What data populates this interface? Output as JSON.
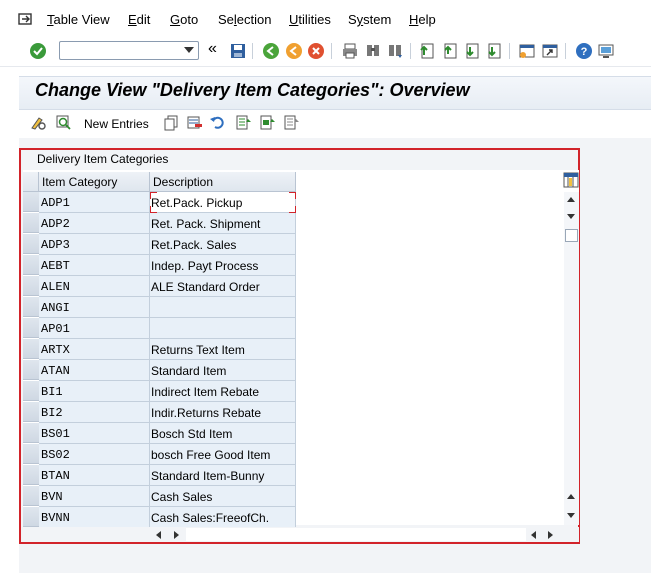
{
  "menu": {
    "items": [
      {
        "label": "Table View",
        "u": "T",
        "rest": "able View"
      },
      {
        "label": "Edit",
        "u": "E",
        "rest": "dit"
      },
      {
        "label": "Goto",
        "u": "G",
        "rest": "oto"
      },
      {
        "label": "Selection",
        "pre": "Se",
        "u": "l",
        "rest": "ection"
      },
      {
        "label": "Utilities",
        "u": "U",
        "rest": "tilities"
      },
      {
        "label": "System",
        "pre": "S",
        "u": "y",
        "rest": "stem"
      },
      {
        "label": "Help",
        "u": "H",
        "rest": "elp"
      }
    ]
  },
  "toolbar": {
    "command_field_value": "",
    "icons": [
      "enter-icon",
      "save-icon",
      "back-icon",
      "exit-icon",
      "cancel-icon",
      "print-icon",
      "find-icon",
      "find-next-icon",
      "first-page-icon",
      "previous-page-icon",
      "next-page-icon",
      "last-page-icon",
      "create-session-icon",
      "shortcut-icon",
      "help-icon",
      "customize-layout-icon"
    ]
  },
  "screen": {
    "title": "Change View \"Delivery Item Categories\": Overview"
  },
  "app_toolbar": {
    "new_entries_label": "New Entries"
  },
  "table": {
    "group_title": "Delivery Item Categories",
    "columns": [
      "Item Category",
      "Description"
    ],
    "rows": [
      {
        "category": "ADP1",
        "description": "Ret.Pack. Pickup"
      },
      {
        "category": "ADP2",
        "description": "Ret. Pack. Shipment"
      },
      {
        "category": "ADP3",
        "description": "Ret.Pack. Sales"
      },
      {
        "category": "AEBT",
        "description": "Indep. Payt Process"
      },
      {
        "category": "ALEN",
        "description": "ALE Standard Order"
      },
      {
        "category": "ANGI",
        "description": ""
      },
      {
        "category": "AP01",
        "description": ""
      },
      {
        "category": "ARTX",
        "description": "Returns Text Item"
      },
      {
        "category": "ATAN",
        "description": "Standard Item"
      },
      {
        "category": "BI1",
        "description": "Indirect Item Rebate"
      },
      {
        "category": "BI2",
        "description": "Indir.Returns Rebate"
      },
      {
        "category": "BS01",
        "description": "Bosch Std Item"
      },
      {
        "category": "BS02",
        "description": "bosch Free Good Item"
      },
      {
        "category": "BTAN",
        "description": "Standard Item-Bunny"
      },
      {
        "category": "BVN",
        "description": "Cash Sales"
      },
      {
        "category": "BVNN",
        "description": "Cash Sales:FreeofCh."
      }
    ]
  },
  "colors": {
    "highlight_border": "#d2232a",
    "cell_bg": "#e8f0f8",
    "header_bg": "#dfe6ee"
  }
}
